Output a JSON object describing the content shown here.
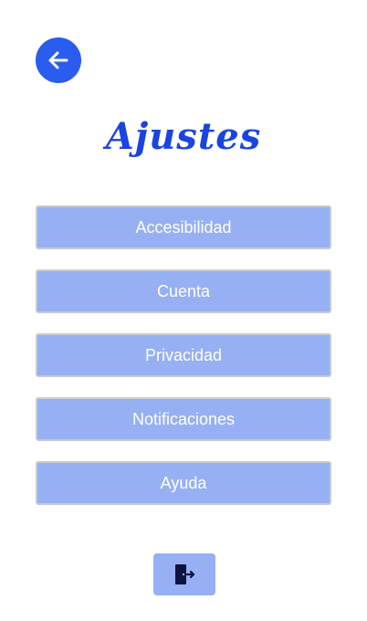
{
  "header": {
    "back_icon": "arrow-left-icon",
    "title": "Ajustes"
  },
  "menu": {
    "items": [
      {
        "label": "Accesibilidad"
      },
      {
        "label": "Cuenta"
      },
      {
        "label": "Privacidad"
      },
      {
        "label": "Notificaciones"
      },
      {
        "label": "Ayuda"
      }
    ]
  },
  "footer": {
    "logout_icon": "logout-icon"
  },
  "colors": {
    "accent": "#2a5cf0",
    "title": "#1a44e0",
    "button_bg": "#96b0f3",
    "button_text": "#ffffff",
    "icon_dark": "#0e1440"
  }
}
